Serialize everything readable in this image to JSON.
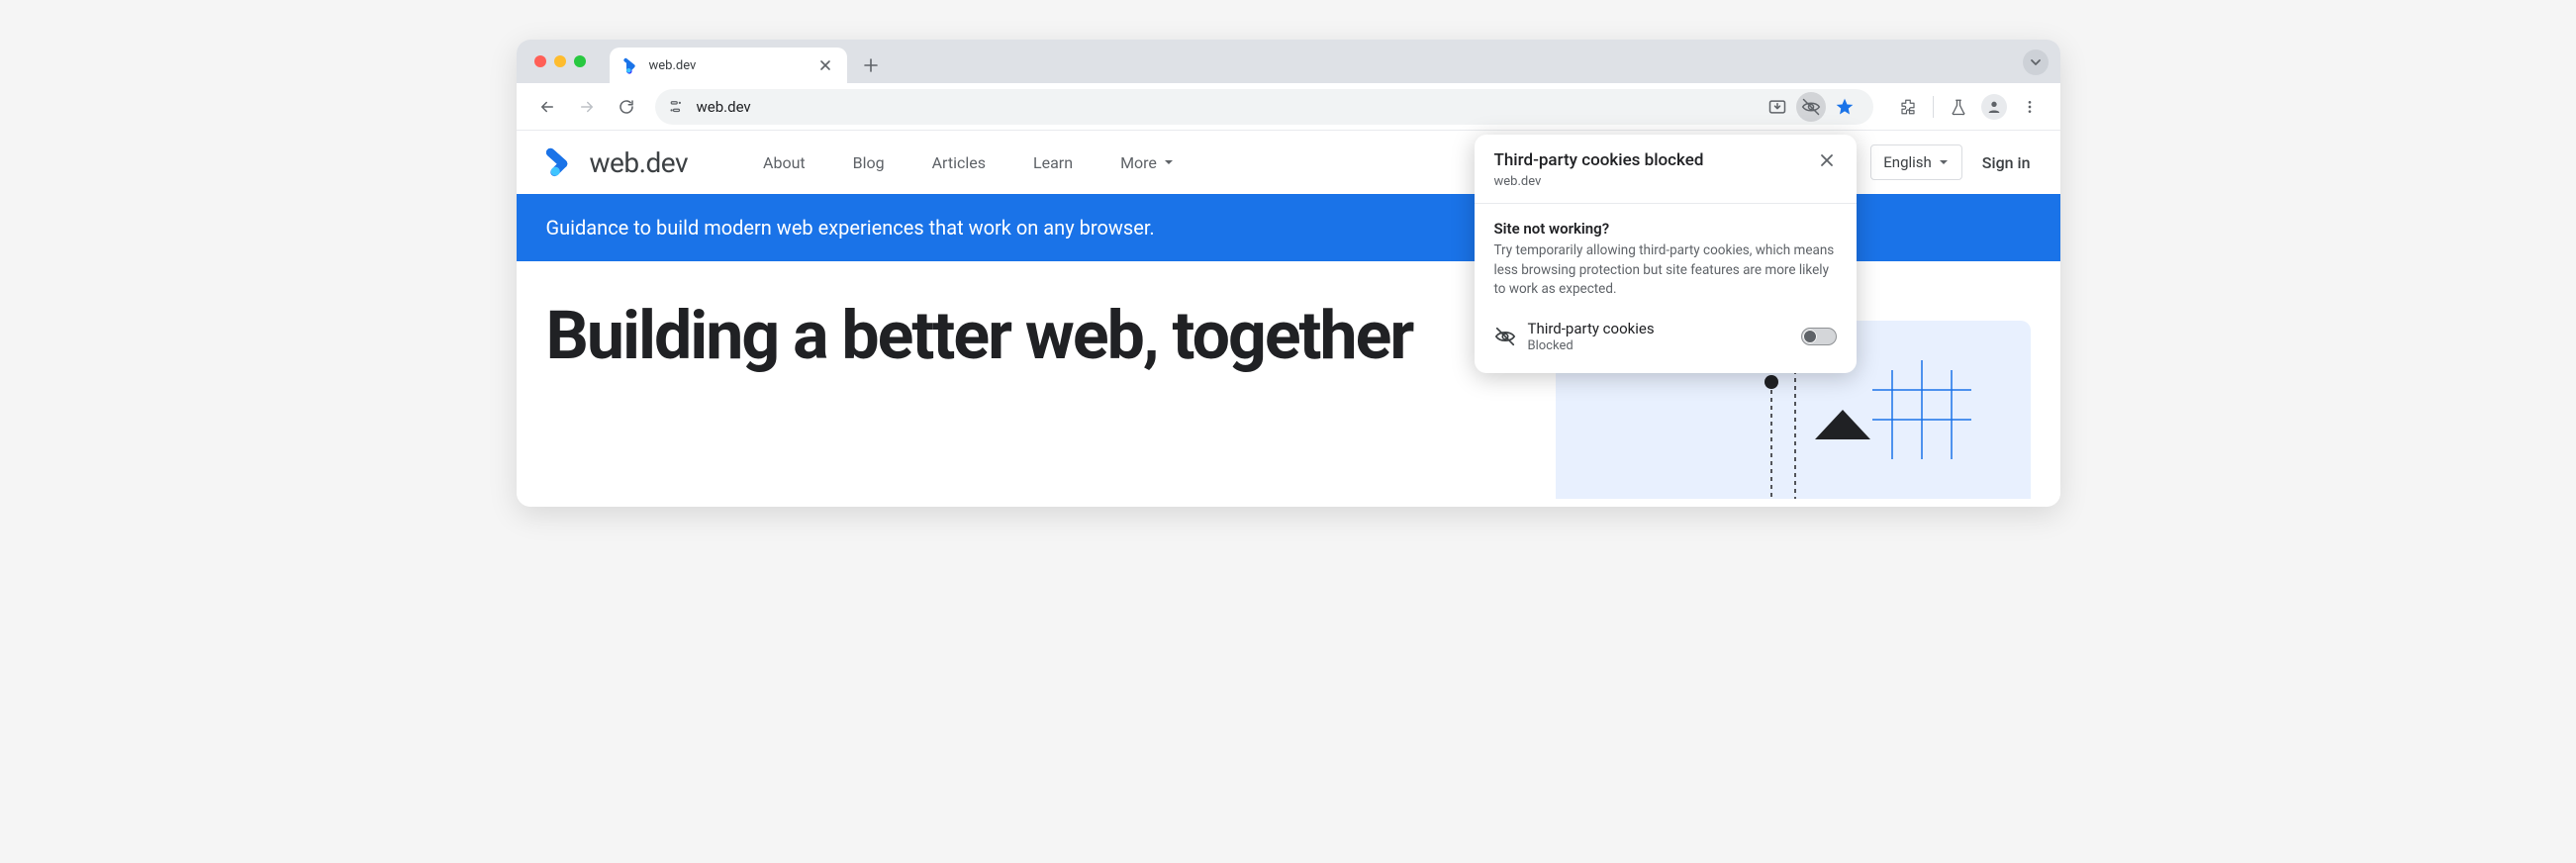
{
  "browser": {
    "tab_title": "web.dev",
    "url": "web.dev"
  },
  "site": {
    "brand": "web.dev",
    "nav": {
      "about": "About",
      "blog": "Blog",
      "articles": "Articles",
      "learn": "Learn",
      "more": "More"
    },
    "language": "English",
    "signin": "Sign in",
    "banner": "Guidance to build modern web experiences that work on any browser.",
    "hero_title": "Building a better web, together"
  },
  "popover": {
    "title": "Third-party cookies blocked",
    "domain": "web.dev",
    "subtitle": "Site not working?",
    "description": "Try temporarily allowing third-party cookies, which means less browsing protection but site features are more likely to work as expected.",
    "row_label": "Third-party cookies",
    "row_status": "Blocked"
  }
}
